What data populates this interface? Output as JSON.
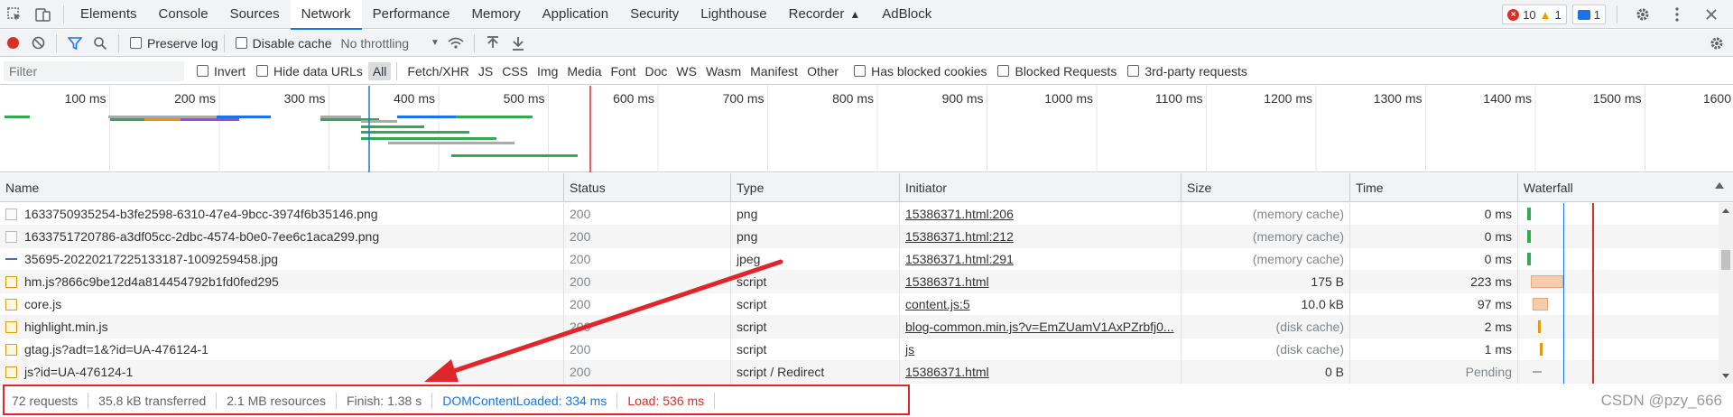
{
  "tabs": [
    "Elements",
    "Console",
    "Sources",
    "Network",
    "Performance",
    "Memory",
    "Application",
    "Security",
    "Lighthouse",
    "Recorder",
    "AdBlock"
  ],
  "active_tab": "Network",
  "badges": {
    "errors": "10",
    "warnings": "1",
    "messages": "1"
  },
  "toolbar": {
    "preserve_log": "Preserve log",
    "disable_cache": "Disable cache",
    "throttling": "No throttling"
  },
  "filterbar": {
    "placeholder": "Filter",
    "invert": "Invert",
    "hide_data_urls": "Hide data URLs",
    "types": [
      "All",
      "Fetch/XHR",
      "JS",
      "CSS",
      "Img",
      "Media",
      "Font",
      "Doc",
      "WS",
      "Wasm",
      "Manifest",
      "Other"
    ],
    "has_blocked_cookies": "Has blocked cookies",
    "blocked_requests": "Blocked Requests",
    "third_party": "3rd-party requests"
  },
  "overview": {
    "ticks": [
      "100 ms",
      "200 ms",
      "300 ms",
      "400 ms",
      "500 ms",
      "600 ms",
      "700 ms",
      "800 ms",
      "900 ms",
      "1000 ms",
      "1100 ms",
      "1200 ms",
      "1300 ms",
      "1400 ms",
      "1500 ms",
      "1600"
    ]
  },
  "columns": [
    "Name",
    "Status",
    "Type",
    "Initiator",
    "Size",
    "Time",
    "Waterfall"
  ],
  "rows": [
    {
      "icon": "img",
      "name": "1633750935254-b3fe2598-6310-47e4-9bcc-3974f6b35146.png",
      "status": "200",
      "type": "png",
      "initiator": "15386371.html:206",
      "size": "(memory cache)",
      "time": "0 ms"
    },
    {
      "icon": "img",
      "name": "1633751720786-a3df05cc-2dbc-4574-b0e0-7ee6c1aca299.png",
      "status": "200",
      "type": "png",
      "initiator": "15386371.html:212",
      "size": "(memory cache)",
      "time": "0 ms"
    },
    {
      "icon": "dash",
      "name": "35695-20220217225133187-1009259458.jpg",
      "status": "200",
      "type": "jpeg",
      "initiator": "15386371.html:291",
      "size": "(memory cache)",
      "time": "0 ms"
    },
    {
      "icon": "script",
      "name": "hm.js?866c9be12d4a814454792b1fd0fed295",
      "status": "200",
      "type": "script",
      "initiator": "15386371.html",
      "size": "175 B",
      "time": "223 ms"
    },
    {
      "icon": "script",
      "name": "core.js",
      "status": "200",
      "type": "script",
      "initiator": "content.js:5",
      "size": "10.0 kB",
      "time": "97 ms"
    },
    {
      "icon": "script",
      "name": "highlight.min.js",
      "status": "200",
      "type": "script",
      "initiator": "blog-common.min.js?v=EmZUamV1AxPZrbfj0...",
      "size": "(disk cache)",
      "time": "2 ms"
    },
    {
      "icon": "script",
      "name": "gtag.js?adt=1&?id=UA-476124-1",
      "status": "200",
      "type": "script",
      "initiator": "js",
      "size": "(disk cache)",
      "time": "1 ms"
    },
    {
      "icon": "script",
      "name": "js?id=UA-476124-1",
      "status": "200",
      "type": "script / Redirect",
      "initiator": "15386371.html",
      "size": "0 B",
      "time": "Pending"
    }
  ],
  "summary": {
    "requests": "72 requests",
    "transferred": "35.8 kB transferred",
    "resources": "2.1 MB resources",
    "finish": "Finish: 1.38 s",
    "dom": "DOMContentLoaded: 334 ms",
    "load": "Load: 536 ms"
  },
  "watermark": "CSDN @pzy_666",
  "colors": {
    "accent": "#1a73e8",
    "error": "#d93025",
    "annotation": "#e0262b"
  }
}
